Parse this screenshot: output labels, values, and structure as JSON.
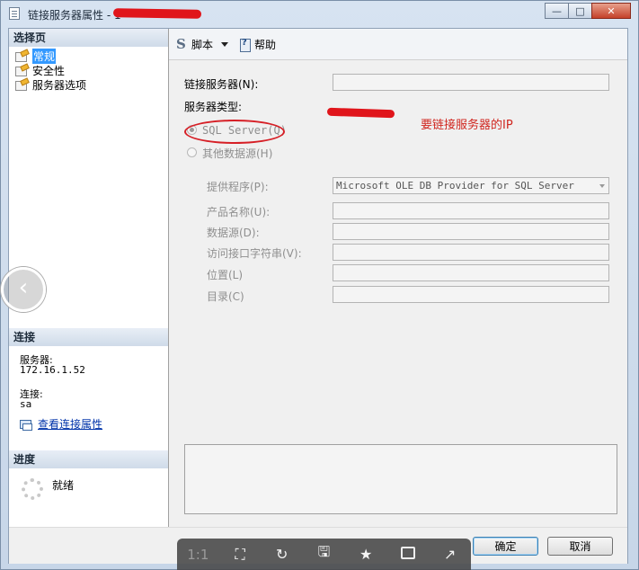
{
  "window": {
    "title": "链接服务器属性 - 1",
    "buttons": {
      "minimize": "—",
      "maximize": "□",
      "close": "✕"
    }
  },
  "left": {
    "select_page_heading": "选择页",
    "pages": [
      {
        "label": "常规",
        "selected": true
      },
      {
        "label": "安全性",
        "selected": false
      },
      {
        "label": "服务器选项",
        "selected": false
      }
    ],
    "connection_heading": "连接",
    "server_label": "服务器:",
    "server_value": "172.16.1.52",
    "conn_label": "连接:",
    "conn_value": "sa",
    "view_conn_props": "查看连接属性",
    "progress_heading": "进度",
    "progress_status": "就绪"
  },
  "toolbar": {
    "script": "脚本",
    "help": "帮助"
  },
  "form": {
    "linked_server_label": "链接服务器(N):",
    "server_type_label": "服务器类型:",
    "radio_sql": "SQL Server(Q)",
    "radio_other": "其他数据源(H)",
    "provider_label": "提供程序(P):",
    "provider_value": "Microsoft OLE DB Provider for SQL Server",
    "product_label": "产品名称(U):",
    "datasource_label": "数据源(D):",
    "access_label": "访问接口字符串(V):",
    "location_label": "位置(L)",
    "catalog_label": "目录(C)",
    "annotation": "要链接服务器的IP"
  },
  "buttons": {
    "ok": "确定",
    "cancel": "取消"
  },
  "viewer": {
    "one_to_one": "1:1"
  },
  "colors": {
    "annotation": "#d0261f",
    "selection": "#3399ff"
  }
}
